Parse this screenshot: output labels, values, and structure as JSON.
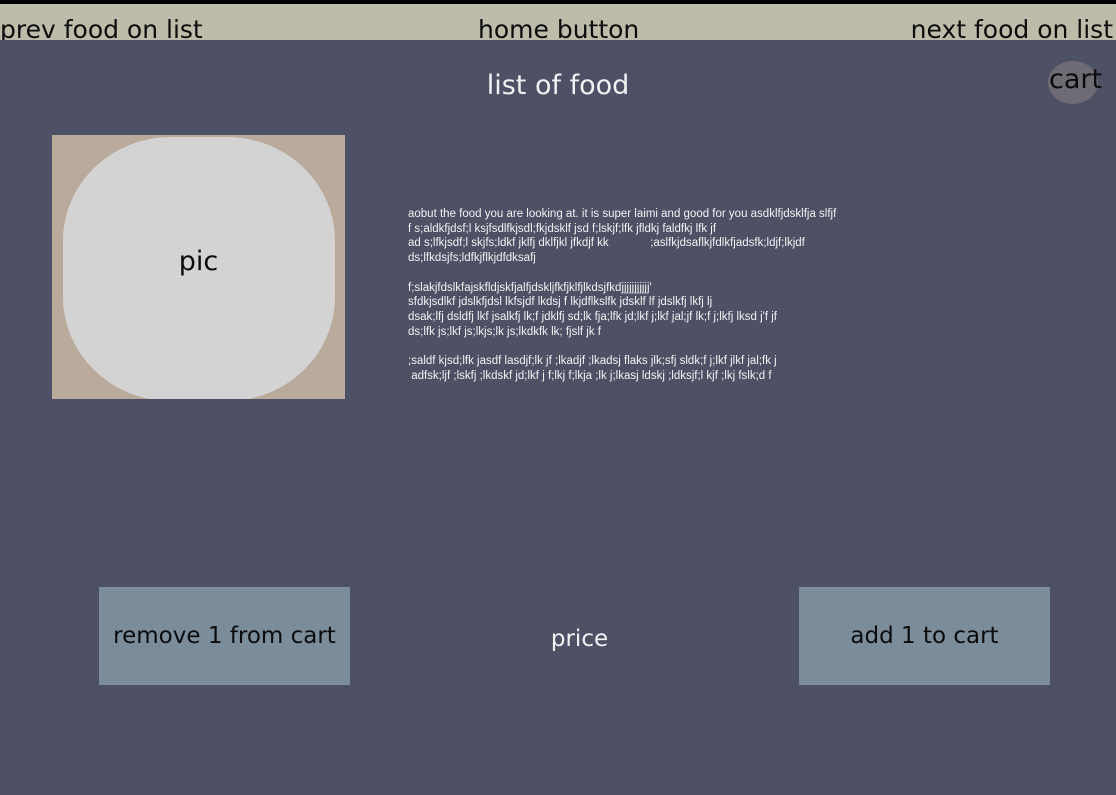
{
  "top_bar": {
    "prev_label": "prev food on list",
    "home_label": "home button",
    "next_label": "next food on list"
  },
  "page_title": "list of food",
  "cart_label": "cart",
  "picture_label": "pic",
  "description": "aobut the food you are looking at. it is super laimi and good for you asdklfjdsklfja slfjf\nf s;aldkfjdsf;l ksjfsdlfkjsdl;fkjdsklf jsd f;lskjf;lfk jfldkj faldfkj lfk jf\nad s;lfkjsdf;l skjfs;ldkf jklfj dklfjkl jfkdjf kk             ;aslfkjdsaflkjfdlkfjadsfk;ldjf;lkjdf\nds;lfkdsjfs;ldfkjflkjdfdksafj\n\nf;slakjfdslkfajskfldjskfjalfjdskljfkfjklfjlkdsjfkdjjjjjjjjjjj'\nsfdkjsdlkf jdslkfjdsl lkfsjdf lkdsj f lkjdflkslfk jdsklf lf jdslkfj lkfj lj\ndsak;lfj dsldfj lkf jsalkfj lk;f jdklfj sd;lk fja;lfk jd;lkf j;lkf jal;jf lk;f j;lkfj lksd j'f jf\nds;lfk js;lkf js;lkjs;lk js;lkdkfk lk; fjslf jk f\n\n;saldf kjsd;lfk jasdf lasdjf;lk jf ;lkadjf ;lkadsj flaks jlk;sfj sldk;f j;lkf jlkf jal;fk j\n adfsk;ljf ;lskfj ;lkdskf jd;lkf j f;lkj f;lkja ;lk j;lkasj ldskj ;ldksjf;l kjf ;lkj fslk;d f",
  "buttons": {
    "remove_label": "remove 1 from cart",
    "add_label": "add 1 to cart"
  },
  "price_label": "price",
  "colors": {
    "background": "#4e5066",
    "top_bar": "#bdbcaa",
    "button": "#7b8c9b",
    "picture_frame": "#baaa9b",
    "picture_placeholder": "#d3d3d3",
    "cart_circle": "#6e6b74"
  }
}
